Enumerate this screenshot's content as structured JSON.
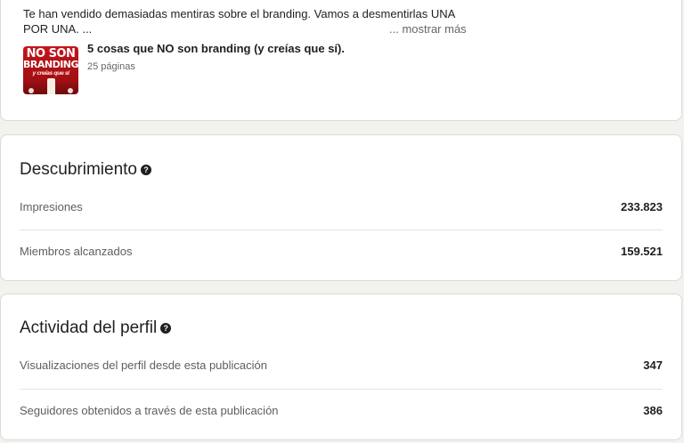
{
  "post": {
    "text": "Te han vendido demasiadas mentiras sobre el branding. Vamos a desmentirlas UNA POR UNA. ...",
    "show_more": "... mostrar más",
    "document": {
      "title": "5 cosas que NO son branding (y creías que sí).",
      "pages": "25 páginas",
      "thumbnail": {
        "line1": "NO SON",
        "line2": "BRANDING",
        "line3": "y creías que sí"
      }
    }
  },
  "discovery": {
    "title": "Descubrimiento",
    "rows": [
      {
        "label": "Impresiones",
        "value": "233.823"
      },
      {
        "label": "Miembros alcanzados",
        "value": "159.521"
      }
    ]
  },
  "profile_activity": {
    "title": "Actividad del perfil",
    "rows": [
      {
        "label": "Visualizaciones del perfil desde esta publicación",
        "value": "347"
      },
      {
        "label": "Seguidores obtenidos a través de esta publicación",
        "value": "386"
      }
    ]
  },
  "icons": {
    "help": "help-icon",
    "help_glyph": "?"
  },
  "colors": {
    "background": "#f4f2ee",
    "card": "#ffffff",
    "thumbnail_red": "#c4161c"
  }
}
